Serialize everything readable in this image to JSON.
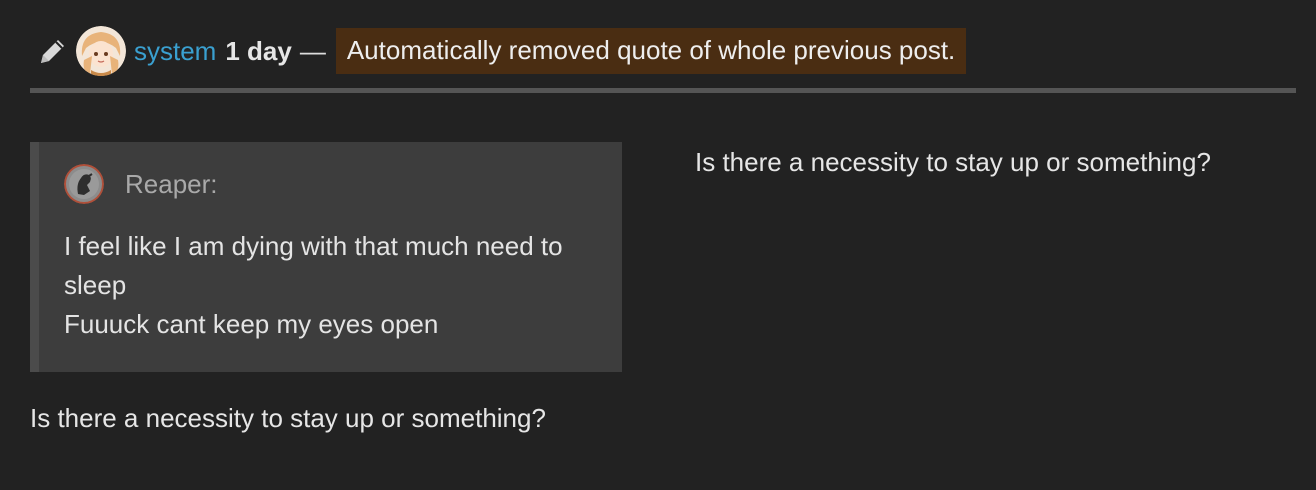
{
  "header": {
    "icon": "pencil-icon",
    "username": "system",
    "age": "1 day",
    "dash": "—",
    "edit_reason": "Automatically removed quote of whole previous post."
  },
  "previous_version": {
    "quote": {
      "author": "Reaper:",
      "lines": [
        "I feel like I am dying with that much need to",
        "sleep",
        "Fuuuck cant keep my eyes open"
      ]
    },
    "text": "Is there a necessity to stay up or something?"
  },
  "current_version": {
    "text": "Is there a necessity to stay up or something?"
  },
  "colors": {
    "background": "#222222",
    "link": "#3aa0d0",
    "edit_reason_bg": "#4a2d12",
    "quote_bg": "#3d3d3d"
  }
}
